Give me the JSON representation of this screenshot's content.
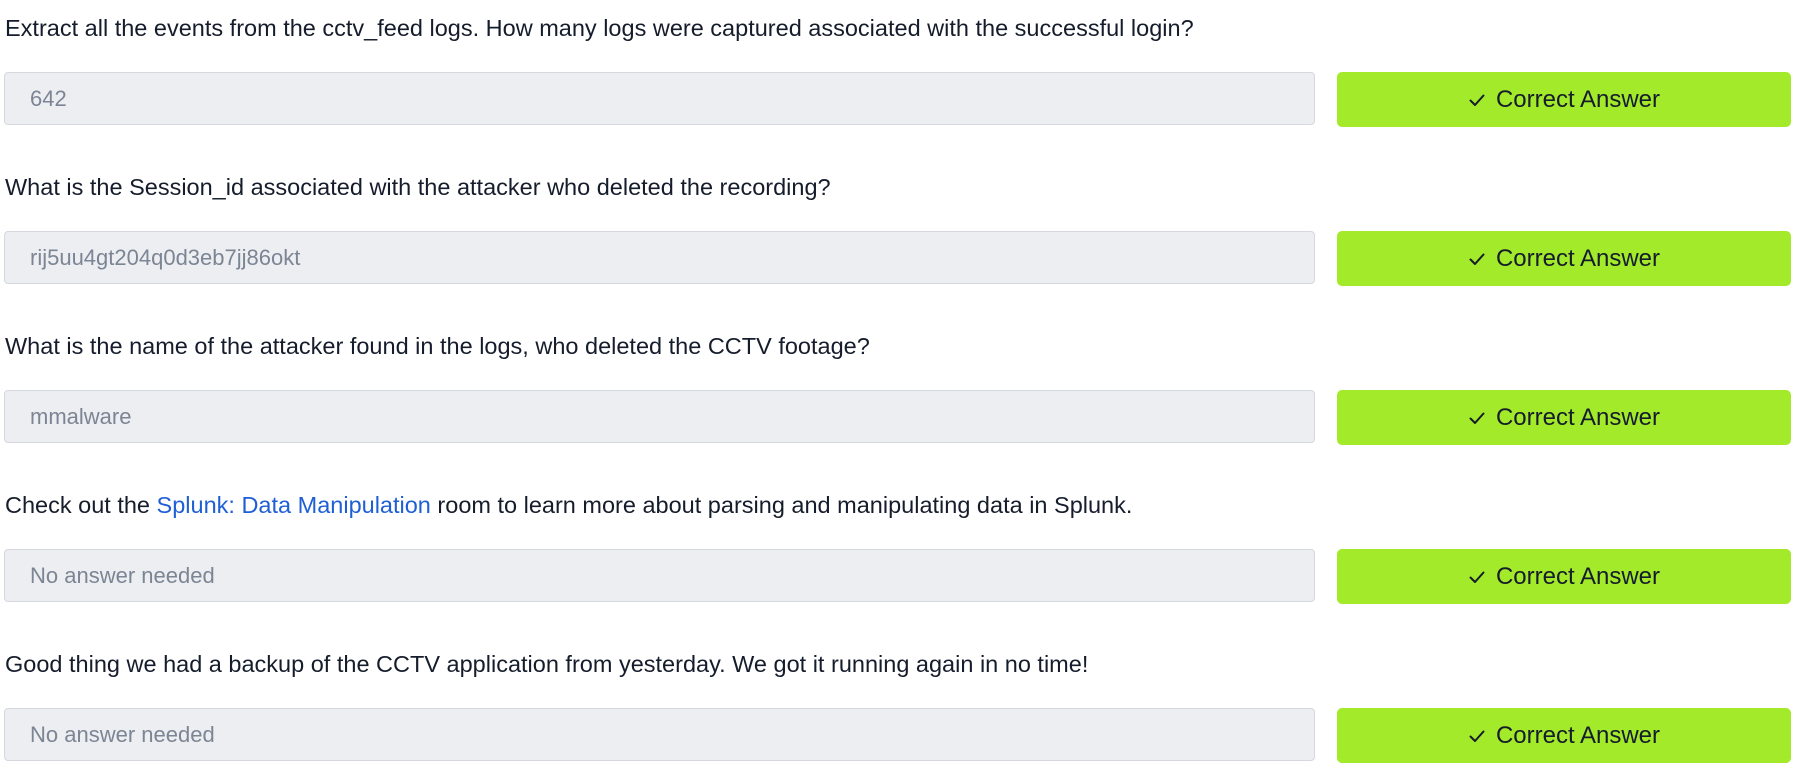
{
  "questions": [
    {
      "text": "Extract all the events from the cctv_feed logs. How many logs were captured associated with the successful login?",
      "answer": "642",
      "button_label": "Correct Answer"
    },
    {
      "text": "What is the Session_id associated with the attacker who deleted the recording?",
      "answer": "rij5uu4gt204q0d3eb7jj86okt",
      "button_label": "Correct Answer"
    },
    {
      "text": "What is the name of the attacker found in the logs, who deleted the CCTV footage?",
      "answer": "mmalware",
      "button_label": "Correct Answer"
    },
    {
      "text_before": "Check out the ",
      "link_text": "Splunk: Data Manipulation",
      "text_after": " room to learn more about parsing and manipulating data in Splunk.",
      "answer": "No answer needed",
      "button_label": "Correct Answer"
    },
    {
      "text": "Good thing we had a backup of the CCTV application from yesterday. We got it running again in no time!",
      "answer": "No answer needed",
      "button_label": "Correct Answer"
    }
  ],
  "icons": {
    "button_icon": "check-icon"
  },
  "colors": {
    "button_bg": "#a3ea2a",
    "field_bg": "#edeef2",
    "link": "#1f5fd6",
    "text": "#151c2b",
    "field_text": "#7c8594"
  }
}
